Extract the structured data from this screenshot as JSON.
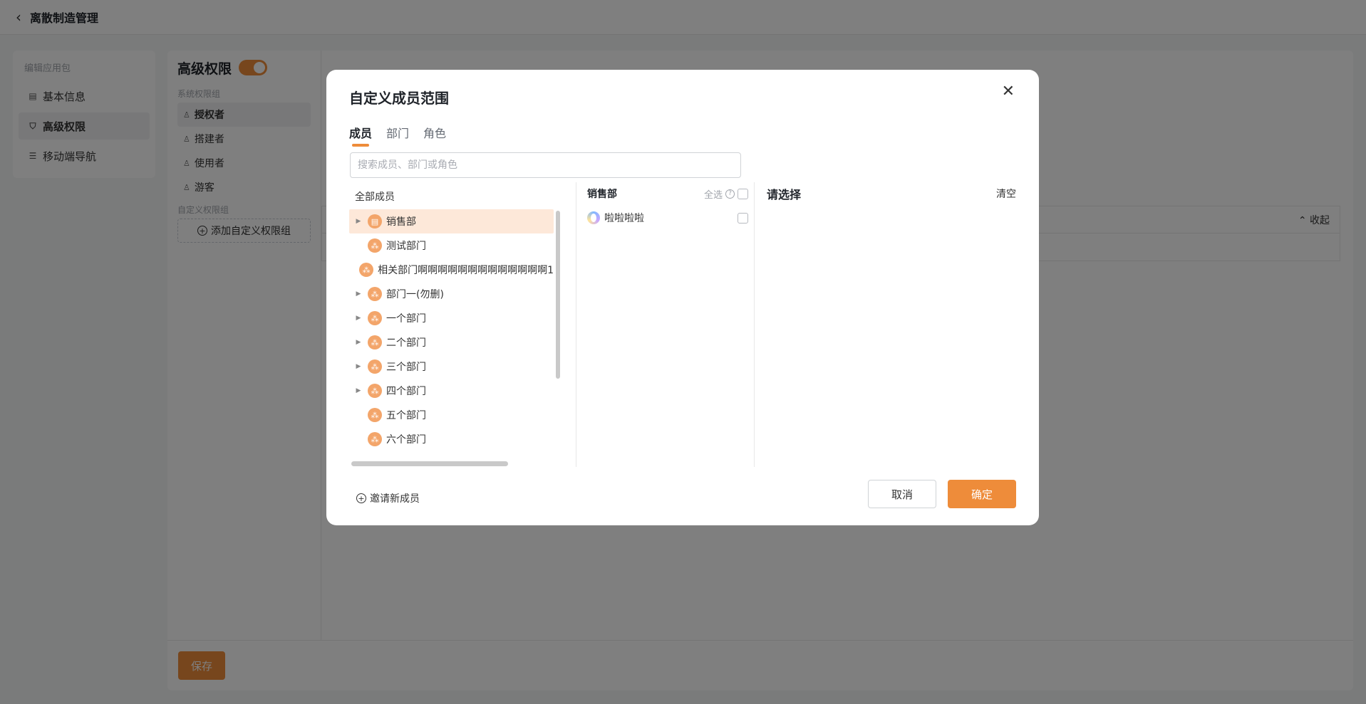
{
  "page": {
    "title": "离散制造管理",
    "nav_group_label": "编辑应用包",
    "nav_items": [
      {
        "label": "基本信息",
        "icon": "doc-icon"
      },
      {
        "label": "高级权限",
        "icon": "shield-icon"
      },
      {
        "label": "移动端导航",
        "icon": "sliders-icon"
      }
    ],
    "perm_title": "高级权限",
    "perm_enabled": true,
    "system_group_label": "系统权限组",
    "roles": [
      "授权者",
      "搭建者",
      "使用者",
      "游客"
    ],
    "custom_group_label": "自定义权限组",
    "add_custom_group": "添加自定义权限组",
    "collapse_label": "收起",
    "save_label": "保存"
  },
  "modal": {
    "title": "自定义成员范围",
    "tabs": [
      "成员",
      "部门",
      "角色"
    ],
    "active_tab": "成员",
    "search_placeholder": "搜索成员、部门或角色",
    "tree_header": "全部成员",
    "tree": [
      {
        "label": "销售部",
        "expandable": true,
        "selected": true
      },
      {
        "label": "测试部门",
        "expandable": false
      },
      {
        "label": "相关部门啊啊啊啊啊啊啊啊啊啊啊啊啊1",
        "expandable": false
      },
      {
        "label": "部门一(勿删)",
        "expandable": true
      },
      {
        "label": "一个部门",
        "expandable": true
      },
      {
        "label": "二个部门",
        "expandable": true
      },
      {
        "label": "三个部门",
        "expandable": true
      },
      {
        "label": "四个部门",
        "expandable": true
      },
      {
        "label": "五个部门",
        "expandable": false
      },
      {
        "label": "六个部门",
        "expandable": false
      }
    ],
    "member_dept": "销售部",
    "select_all": "全选",
    "members": [
      {
        "name": "啦啦啦啦"
      }
    ],
    "selected_placeholder": "请选择",
    "clear_label": "清空",
    "invite_label": "邀请新成员",
    "cancel_label": "取消",
    "ok_label": "确定"
  },
  "colors": {
    "accent": "#ee8c3a",
    "selected_bg": "#fde8d9"
  }
}
